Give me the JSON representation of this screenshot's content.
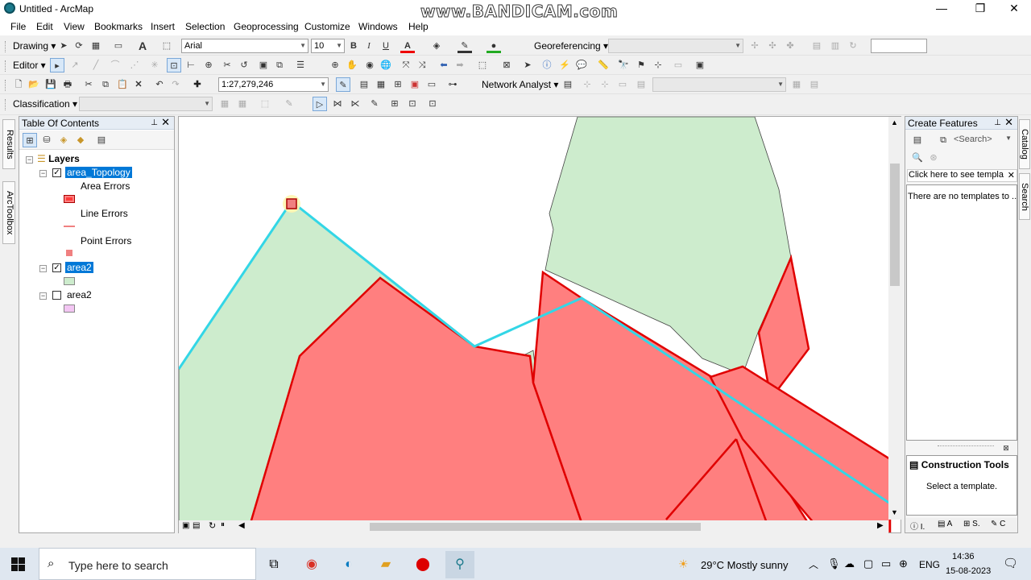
{
  "window": {
    "title": "Untitled - ArcMap",
    "watermark": "www.BANDICAM.com",
    "minimize": "—",
    "maximize": "❐",
    "close": "✕"
  },
  "menu": [
    "File",
    "Edit",
    "View",
    "Bookmarks",
    "Insert",
    "Selection",
    "Geoprocessing",
    "Customize",
    "Windows",
    "Help"
  ],
  "toolbars": {
    "drawing_label": "Drawing ▾",
    "font_name": "Arial",
    "font_size": "10",
    "bold": "B",
    "italic": "I",
    "underline": "U",
    "georeferencing_label": "Georeferencing ▾",
    "editor_label": "Editor ▾",
    "scale_value": "1:27,279,246",
    "network_analyst_label": "Network Analyst ▾",
    "classification_label": "Classification ▾"
  },
  "toc": {
    "title": "Table Of Contents",
    "pin": "📌",
    "close": "✕",
    "root_label": "Layers",
    "layers": [
      {
        "name": "area_Topology",
        "checked": true,
        "selected": true
      },
      {
        "name": "area2",
        "checked": true,
        "selected": true
      },
      {
        "name": "area2",
        "checked": false,
        "selected": false
      }
    ],
    "legend": {
      "area_errors": "Area Errors",
      "line_errors": "Line Errors",
      "point_errors": "Point Errors"
    },
    "colors": {
      "area_errors": "#ff3b3b",
      "line_errors": "#f08080",
      "point_errors": "#f08080",
      "area2_fill": "#cdeccd",
      "area2_unchecked_fill": "#f3c6f3"
    }
  },
  "map": {
    "colors": {
      "polygon_fill": "#cdeccd",
      "error_fill": "#ff7f7f",
      "error_stroke": "#e00000",
      "topology_line": "#33d6e6"
    }
  },
  "create_features": {
    "title": "Create Features",
    "search_placeholder": "<Search>",
    "hint": "Click here to see templa",
    "no_templates": "There are no templates to ...",
    "construction_title": "Construction Tools",
    "construction_text": "Select a template."
  },
  "side_tabs": {
    "left": [
      "Results",
      "ArcToolbox"
    ],
    "right": [
      "Catalog",
      "Search"
    ]
  },
  "taskbar": {
    "search_placeholder": "Type here to search",
    "weather": "29°C  Mostly sunny",
    "language": "ENG",
    "time": "14:36",
    "date": "15-08-2023"
  }
}
